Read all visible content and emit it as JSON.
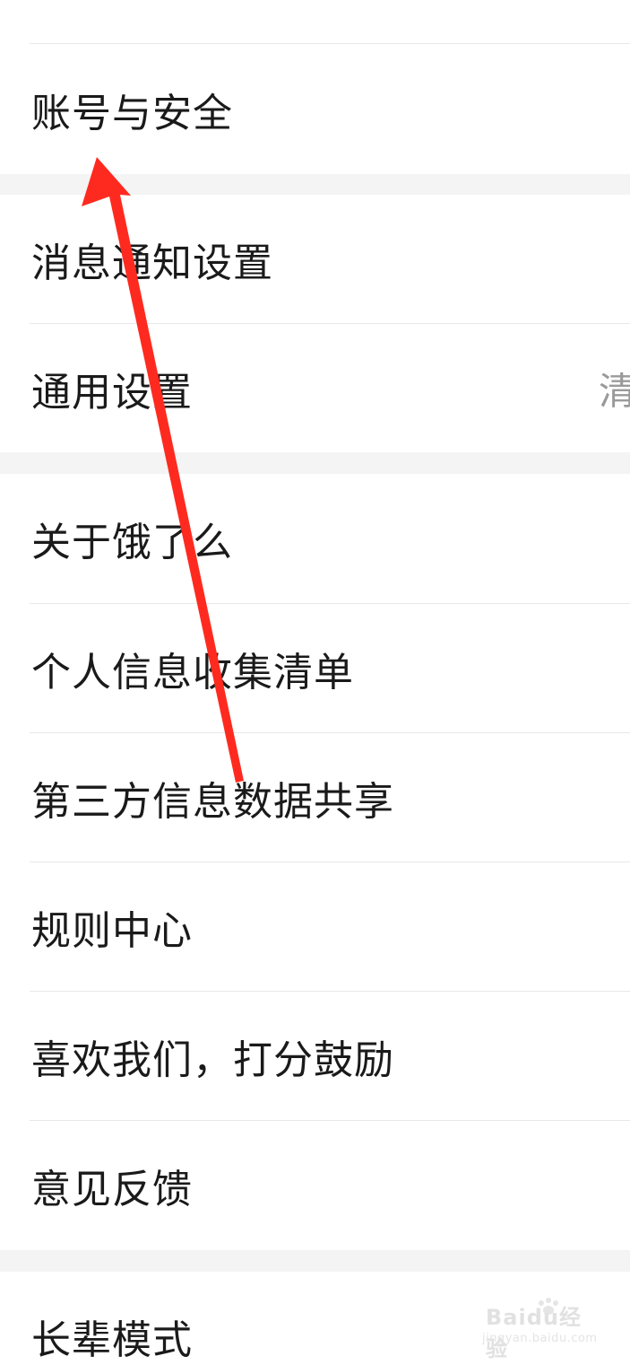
{
  "settings": {
    "groups": [
      {
        "items": [
          {
            "label": "账号与安全"
          }
        ]
      },
      {
        "items": [
          {
            "label": "消息通知设置"
          },
          {
            "label": "通用设置",
            "value": "清"
          }
        ]
      },
      {
        "items": [
          {
            "label": "关于饿了么"
          },
          {
            "label": "个人信息收集清单"
          },
          {
            "label": "第三方信息数据共享"
          },
          {
            "label": "规则中心"
          },
          {
            "label": "喜欢我们，打分鼓励"
          },
          {
            "label": "意见反馈"
          }
        ]
      },
      {
        "items": [
          {
            "label": "长辈模式"
          }
        ]
      }
    ]
  },
  "annotation": {
    "arrow_color": "#ff2a1f",
    "points_to": "账号与安全"
  },
  "watermark": {
    "brand": "Baidu经验",
    "url": "jingyan.baidu.com"
  },
  "colors": {
    "page_bg": "#ffffff",
    "group_gap": "#f4f4f4",
    "divider": "#e8e8e8",
    "label_text": "#1a1a1a",
    "value_text": "#9a9a9a"
  }
}
